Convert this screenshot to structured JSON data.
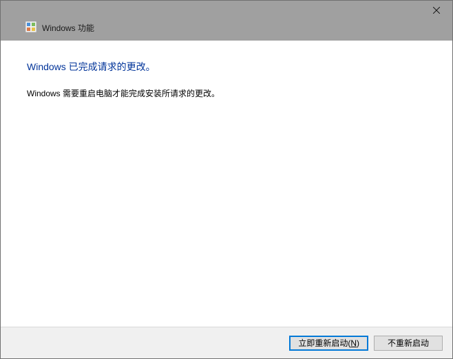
{
  "titlebar": {
    "title": "Windows 功能"
  },
  "content": {
    "heading": "Windows 已完成请求的更改。",
    "body": "Windows 需要重启电脑才能完成安装所请求的更改。"
  },
  "footer": {
    "restart_now_prefix": "立即重新启动(",
    "restart_now_mnemonic": "N",
    "restart_now_suffix": ")",
    "dont_restart": "不重新启动"
  }
}
